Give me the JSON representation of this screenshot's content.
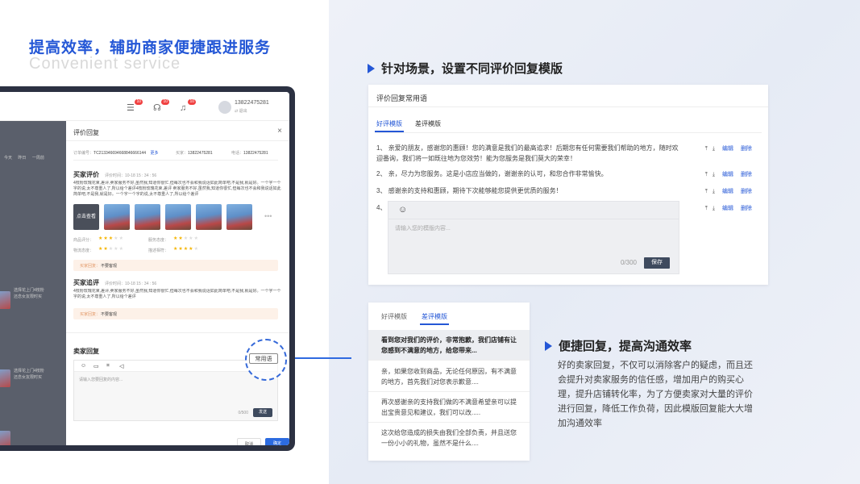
{
  "hero": {
    "title": "提高效率，辅助商家便捷跟进服务",
    "subtitle": "Convenient service"
  },
  "tablet": {
    "topbar": {
      "badges": [
        "10",
        "10",
        "10"
      ],
      "user_phone": "13822475281",
      "user_sub": "⇄ 退出"
    },
    "background_list": {
      "labels": [
        "今天",
        "昨日",
        "一周前"
      ],
      "rows": [
        "选择花上门4枝粉",
        "还念女友限时买",
        "选择花上门4枝粉",
        "还念女友限时买"
      ]
    },
    "dialog": {
      "title": "评价回复",
      "order_label": "订单编号：",
      "order_no": "TC213346694668846666144",
      "more": "更多",
      "buyer_label": "买家：",
      "buyer": "13822475281",
      "phone_label": "电话：",
      "phone": "13822475281",
      "buyer_review_title": "买家评价",
      "review_time": "评价时间：10-18 15 : 34 : 56",
      "review_text": "4枝粉玫瑰花束,差评,卖家服务不好,虽然我,知道你很忙,但每次也不会和我说话如此简单吧,不是我,就是好。一个字一个字的说,太不尊重人了,所以给个差评4枝粉玫瑰花束,差评 卖家服务不好,虽然我,知道你很忙,但每次也不会和我说话如此简单吧,不是我,就是好。一个字一个字的说,太不尊重人了,所以给个差评",
      "photo_first": "点击查看",
      "rating_labels": [
        "商品评分：",
        "服务态度：",
        "物流态度：",
        "描述相符："
      ],
      "ratings": [
        3,
        2,
        2,
        4
      ],
      "tag_label": "买家回复：",
      "tag_value": "不要客观",
      "followup_title": "买家追评",
      "followup_time": "评价时间：10-18 15 : 34 : 56",
      "followup_text": "4枝粉玫瑰花束,差评,卖家服务不好,虽然我,知道你很忙,但每次也不会和我说话如此简单吧,不是我,就是好。一个字一个字的说,太不尊重人了,所以给个差评",
      "seller_reply_title": "卖家回复",
      "common_phrases": "常用语",
      "reply_placeholder": "请输入您要回复的内容...",
      "reply_count": "0/500",
      "send": "发送",
      "cancel": "取消",
      "confirm": "确定"
    }
  },
  "section1": {
    "heading": "针对场景，设置不同评价回复模版",
    "card_title": "评价回复常用语",
    "tabs": [
      "好评模版",
      "差评模版"
    ],
    "items": [
      {
        "n": "1、",
        "text": "亲爱的朋友，感谢您的惠顾！您的满意是我们的最高追求！后期您有任何需要我们帮助的地方，随时欢迎番询，我们将一如既往地为您效劳！能为您服务是我们莫大的荣幸！"
      },
      {
        "n": "2、",
        "text": "亲，尽力为您服务。这是小店应当做的，谢谢亲的认可，和您合作非常愉快。"
      },
      {
        "n": "3、",
        "text": "感谢亲的支持和惠顾，期待下次能够能您提供更优质的服务！"
      },
      {
        "n": "4、",
        "text": ""
      }
    ],
    "edit": "编辑",
    "delete": "删除",
    "input_placeholder": "请输入您的模版内容...",
    "input_count": "0/300",
    "save": "保存"
  },
  "section2": {
    "tabs": [
      "好评模版",
      "差评模版"
    ],
    "items": [
      "看到您对我们的评价，非常抱歉，我们店铺有让您感到不满意的地方，给您带来...",
      "亲，如果您收到商品，无论任何原因，有不满意的地方，首先我们对您表示歉意....",
      "再次感谢亲的支持我们做的不满意希望亲可以提出宝贵意见和建议，我们可以改.....",
      "这次给您造成的损失由我们全部负责，并且送您一份小小的礼物，虽然不是什么...."
    ]
  },
  "section3": {
    "heading": "便捷回复，提高沟通效率",
    "body": "好的卖家回复，不仅可以消除客户的疑虑，而且还会提升对卖家服务的信任感，增加用户的购买心理，提升店铺转化率，为了方便卖家对大量的评价进行回复，降低工作负荷，因此模版回复能大大增加沟通效率"
  },
  "colors": {
    "accent": "#2457d6",
    "dark_button": "#3e4a5e",
    "star": "#f5b400",
    "badge": "#f04141"
  }
}
